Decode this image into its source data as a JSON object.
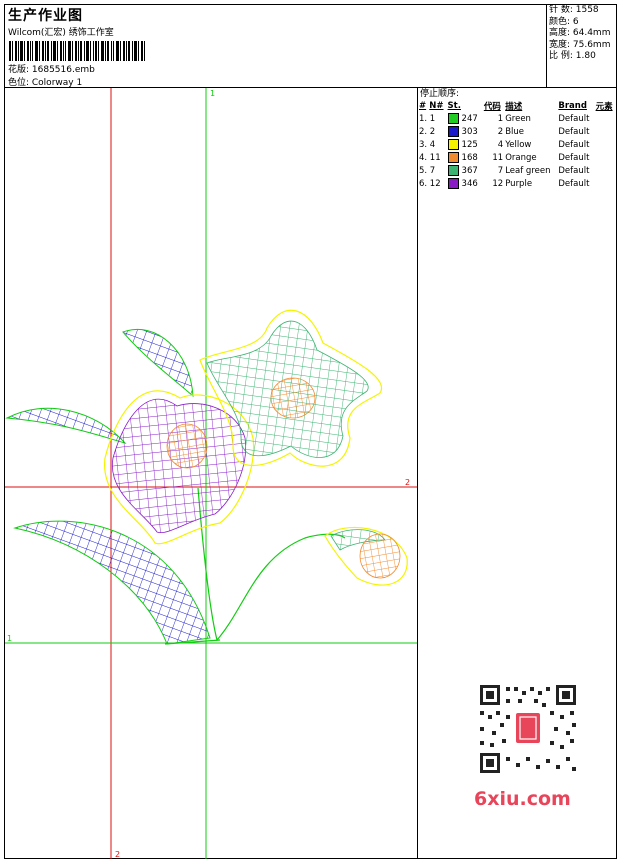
{
  "header": {
    "title": "生产作业图",
    "studio": "Wilcom(汇宏) 绣饰工作室",
    "pattern_label": "花版: 1685516.emb",
    "colorway_label": "色位: Colorway 1"
  },
  "stats": {
    "stitches": "针 数: 1558",
    "colors": "颜色: 6",
    "height": "高度: 64.4mm",
    "width": "宽度: 75.6mm",
    "ratio": "比 例: 1.80"
  },
  "stop_sequence": {
    "caption": "停止顺序:",
    "headers": [
      "#",
      "N#",
      "St.",
      "代码",
      "描述",
      "Brand",
      "元素"
    ],
    "rows": [
      {
        "idx": "1. 1",
        "color": "#22cc22",
        "st": "247",
        "code": "1",
        "desc": "Green",
        "brand": "Default"
      },
      {
        "idx": "2. 2",
        "color": "#1a1acc",
        "st": "303",
        "code": "2",
        "desc": "Blue",
        "brand": "Default"
      },
      {
        "idx": "3. 4",
        "color": "#f4f400",
        "st": "125",
        "code": "4",
        "desc": "Yellow",
        "brand": "Default"
      },
      {
        "idx": "4. 11",
        "color": "#f08c30",
        "st": "168",
        "code": "11",
        "desc": "Orange",
        "brand": "Default"
      },
      {
        "idx": "5. 7",
        "color": "#3cb371",
        "st": "367",
        "code": "7",
        "desc": "Leaf green",
        "brand": "Default"
      },
      {
        "idx": "6. 12",
        "color": "#8a1cc8",
        "st": "346",
        "code": "12",
        "desc": "Purple",
        "brand": "Default"
      }
    ]
  },
  "axis_labels": {
    "green_v": "1",
    "red_h": "2",
    "green_h": "1",
    "red_v": "2"
  },
  "watermark": "6xiu.com",
  "colors": {
    "guide_red": "#dd1111",
    "guide_green": "#11cc11",
    "qr_badge": "#e8445a"
  }
}
